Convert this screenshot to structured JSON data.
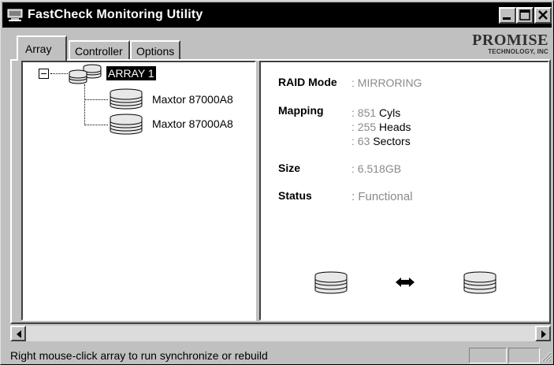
{
  "window": {
    "title": "FastCheck Monitoring Utility",
    "icon": "app-monitor-icon",
    "controls": [
      "minimize-icon",
      "maximize-icon",
      "close-icon"
    ]
  },
  "logo": {
    "main": "PROMISE",
    "sub": "TECHNOLOGY, INC"
  },
  "tabs": [
    {
      "label": "Array",
      "selected": true
    },
    {
      "label": "Controller",
      "selected": false
    },
    {
      "label": "Options",
      "selected": false
    }
  ],
  "tree": {
    "array": {
      "label": "ARRAY 1",
      "expanded": true,
      "icon": "array-icon"
    },
    "disks": [
      {
        "label": "Maxtor 87000A8",
        "icon": "disk-icon"
      },
      {
        "label": "Maxtor 87000A8",
        "icon": "disk-icon"
      }
    ]
  },
  "details": {
    "raid_mode": {
      "label": "RAID Mode",
      "value": ": MIRRORING"
    },
    "mapping": {
      "label": "Mapping",
      "lines": [
        {
          "prefix": ": 851 ",
          "unit": "Cyls"
        },
        {
          "prefix": ": 255 ",
          "unit": "Heads"
        },
        {
          "prefix": ": 63 ",
          "unit": "Sectors"
        }
      ]
    },
    "size": {
      "label": "Size",
      "value": ": 6.518GB"
    },
    "status": {
      "label": "Status",
      "value": ": Functional"
    }
  },
  "mirror_graphic": {
    "left": "disk-icon",
    "middle": "sync-arrows-icon",
    "right": "disk-icon"
  },
  "statusbar": {
    "text": "Right mouse-click array to run synchronize or rebuild"
  },
  "colors": {
    "titlebar": "#000000",
    "face": "#c0c0c0",
    "value_text": "#8a8a8a"
  }
}
